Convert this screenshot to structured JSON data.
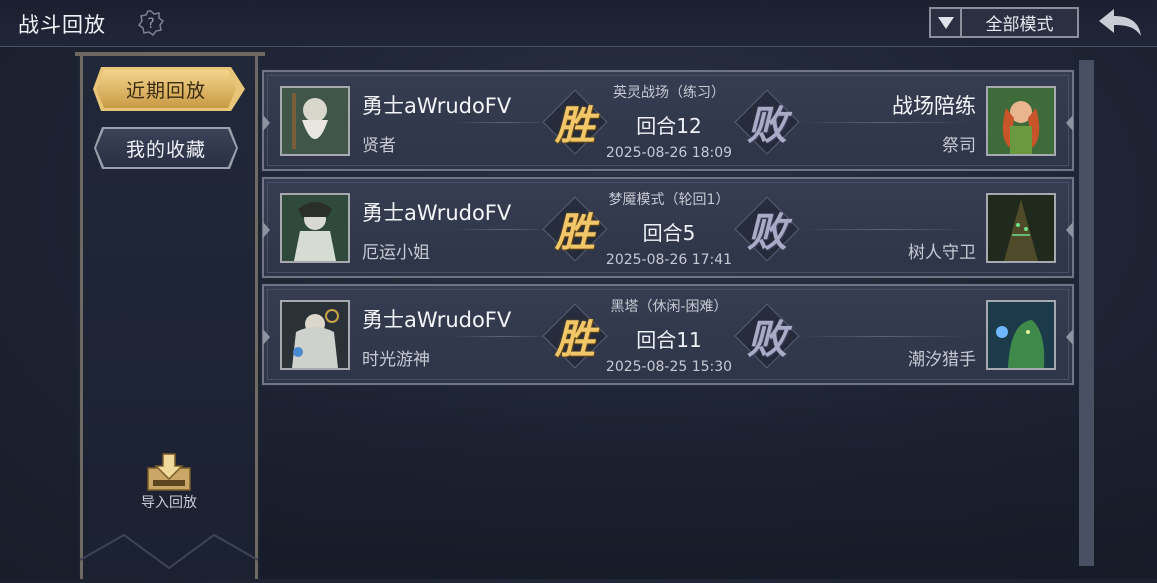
{
  "header": {
    "title": "战斗回放",
    "mode_filter": "全部模式"
  },
  "sidebar": {
    "tabs": [
      {
        "label": "近期回放",
        "active": true
      },
      {
        "label": "我的收藏",
        "active": false
      }
    ],
    "import_label": "导入回放"
  },
  "colors": {
    "win": "#f2c76a",
    "lose": "#a9aac6",
    "active_tab": "#e9c57a"
  },
  "records": [
    {
      "player_name": "勇士aWrudoFV",
      "player_hero": "贤者",
      "mode": "英灵战场（练习）",
      "round": "回合12",
      "date": "2025-08-26 18:09",
      "left_result": "胜",
      "right_result": "败",
      "opponent_name": "战场陪练",
      "opponent_hero": "祭司",
      "left_avatar": "sage-portrait",
      "right_avatar": "priestess-portrait"
    },
    {
      "player_name": "勇士aWrudoFV",
      "player_hero": "厄运小姐",
      "mode": "梦魇模式（轮回1）",
      "round": "回合5",
      "date": "2025-08-26 17:41",
      "left_result": "胜",
      "right_result": "败",
      "opponent_name": "",
      "opponent_hero": "树人守卫",
      "left_avatar": "miss-fortune-portrait",
      "right_avatar": "treant-portrait"
    },
    {
      "player_name": "勇士aWrudoFV",
      "player_hero": "时光游神",
      "mode": "黑塔（休闲-困难）",
      "round": "回合11",
      "date": "2025-08-25 15:30",
      "left_result": "胜",
      "right_result": "败",
      "opponent_name": "",
      "opponent_hero": "潮汐猎手",
      "left_avatar": "time-wanderer-portrait",
      "right_avatar": "tide-hunter-portrait"
    }
  ]
}
